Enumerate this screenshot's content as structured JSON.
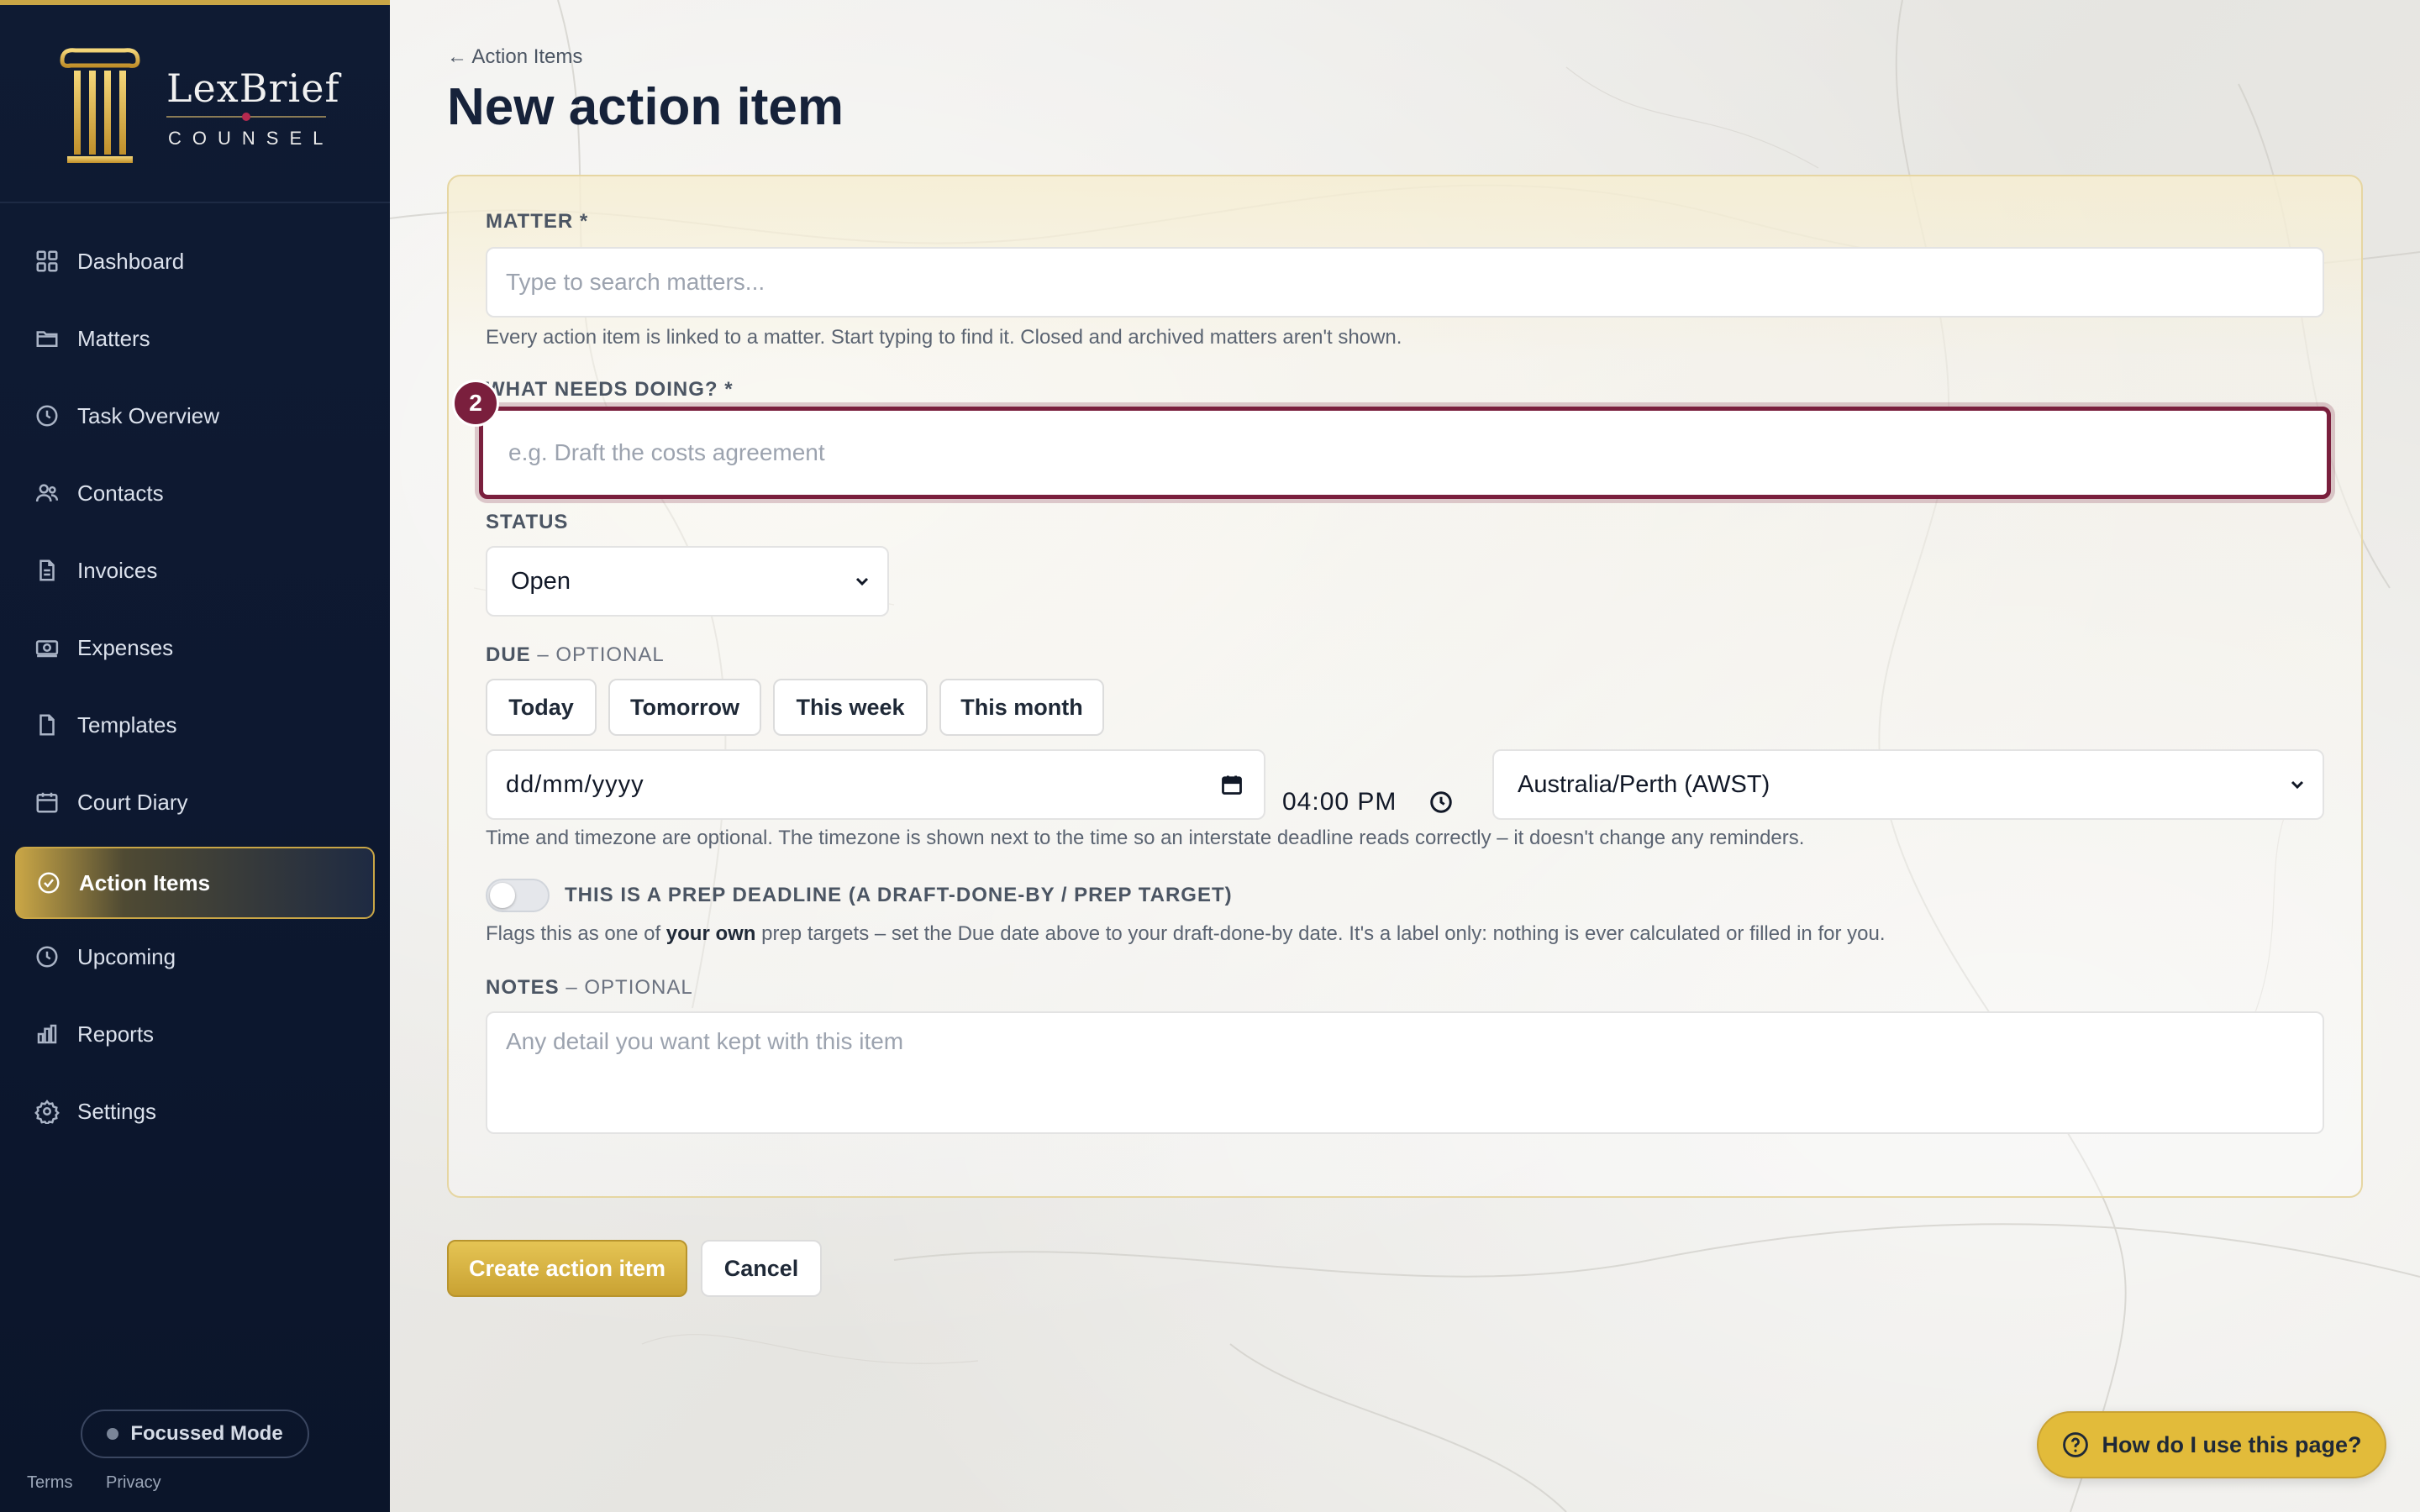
{
  "brand": {
    "name": "LexBrief",
    "sub": "COUNSEL"
  },
  "nav": [
    {
      "label": "Dashboard",
      "icon": "dashboard-grid-icon"
    },
    {
      "label": "Matters",
      "icon": "folder-icon"
    },
    {
      "label": "Task Overview",
      "icon": "clock-icon"
    },
    {
      "label": "Contacts",
      "icon": "users-icon"
    },
    {
      "label": "Invoices",
      "icon": "document-icon"
    },
    {
      "label": "Expenses",
      "icon": "banknote-icon"
    },
    {
      "label": "Templates",
      "icon": "file-icon"
    },
    {
      "label": "Court Diary",
      "icon": "calendar-icon"
    },
    {
      "label": "Action Items",
      "icon": "check-circle-icon",
      "active": true
    },
    {
      "label": "Upcoming",
      "icon": "clock-icon"
    },
    {
      "label": "Reports",
      "icon": "bar-chart-icon"
    },
    {
      "label": "Settings",
      "icon": "gear-icon"
    }
  ],
  "sidebar_footer": {
    "focus_mode": "Focussed Mode",
    "terms": "Terms",
    "privacy": "Privacy"
  },
  "header": {
    "back_link": "← Action Items",
    "title": "New action item"
  },
  "form": {
    "matter": {
      "label": "MATTER *",
      "placeholder": "Type to search matters...",
      "help": "Every action item is linked to a matter. Start typing to find it. Closed and archived matters aren't shown."
    },
    "what": {
      "label": "WHAT NEEDS DOING? *",
      "placeholder": "e.g. Draft the costs agreement",
      "badge": "2"
    },
    "status": {
      "label": "STATUS",
      "value": "Open"
    },
    "due": {
      "label": "DUE",
      "optional": " – OPTIONAL",
      "chips": [
        "Today",
        "Tomorrow",
        "This week",
        "This month"
      ],
      "date_placeholder": "dd/mm/yyyy",
      "time": "04:00 PM",
      "timezone": "Australia/Perth (AWST)",
      "help": "Time and timezone are optional. The timezone is shown next to the time so an interstate deadline reads correctly – it doesn't change any reminders."
    },
    "prep": {
      "label": "THIS IS A PREP DEADLINE (A DRAFT-DONE-BY / PREP TARGET)",
      "help_pre": "Flags this as one of ",
      "help_bold": "your own",
      "help_post": " prep targets – set the Due date above to your draft-done-by date. It's a label only: nothing is ever calculated or filled in for you."
    },
    "notes": {
      "label": "NOTES",
      "optional": " – OPTIONAL",
      "placeholder": "Any detail you want kept with this item"
    }
  },
  "actions": {
    "create": "Create action item",
    "cancel": "Cancel"
  },
  "help_button": "How do I use this page?"
}
